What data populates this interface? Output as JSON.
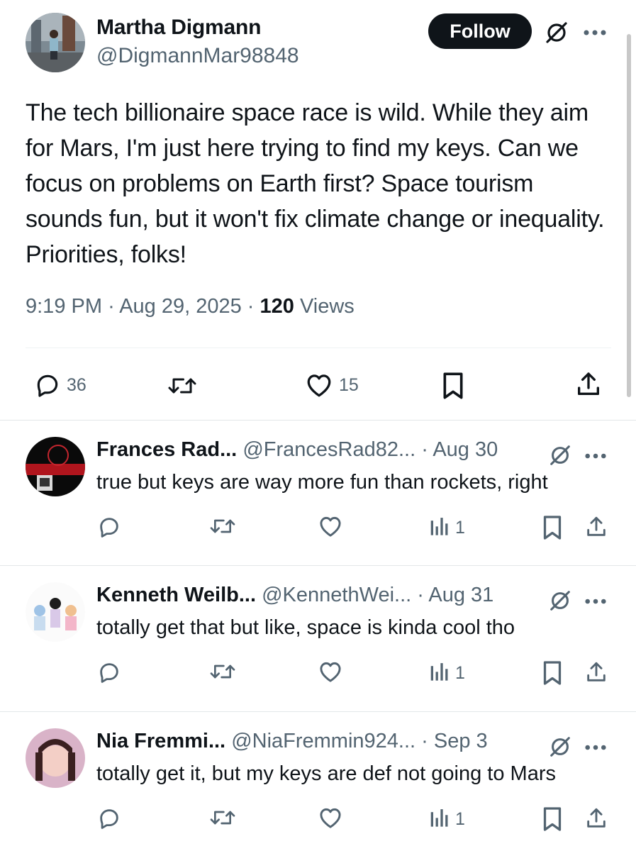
{
  "main_tweet": {
    "author_name": "Martha Digmann",
    "author_handle": "@DigmannMar98848",
    "follow_label": "Follow",
    "text": "The tech billionaire space race is wild. While they aim for Mars, I'm just here trying to find my keys. Can we focus on problems on Earth first? Space tourism sounds fun, but it won't fix climate change or inequality. Priorities, folks!",
    "time": "9:19 PM",
    "date": "Aug 29, 2025",
    "views_count": "120",
    "views_label": "Views",
    "replies": "36",
    "likes": "15",
    "icons": [
      "reply-icon",
      "retweet-icon",
      "like-icon",
      "bookmark-icon",
      "share-icon",
      "grok-icon",
      "more-icon"
    ]
  },
  "replies": [
    {
      "name": "Frances Rad...",
      "handle": "@FrancesRad82...",
      "date": "Aug 30",
      "text": "true but keys are way more fun than rockets, right",
      "views": "1"
    },
    {
      "name": "Kenneth Weilb...",
      "handle": "@KennethWei...",
      "date": "Aug 31",
      "text": "totally get that but like, space is kinda cool tho",
      "views": "1"
    },
    {
      "name": "Nia Fremmi...",
      "handle": "@NiaFremmin924...",
      "date": "Sep 3",
      "text": "totally get it, but my keys are def not going to Mars",
      "views": "1"
    }
  ],
  "colors": {
    "text": "#0f1419",
    "secondary": "#536471",
    "follow_bg": "#0f1419",
    "divider": "#e3e7e9"
  }
}
